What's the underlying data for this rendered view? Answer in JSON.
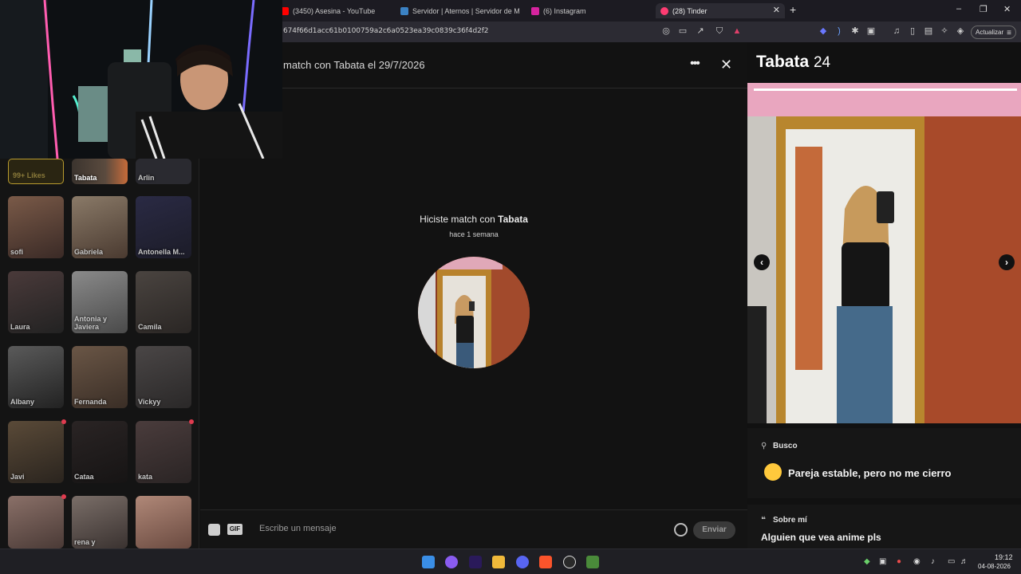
{
  "browser": {
    "tabs": [
      {
        "label": "(3450) Asesina - YouTube",
        "color": "#ff0000"
      },
      {
        "label": "Servidor | Aternos | Servidor de Mine",
        "color": "#3b82c4"
      },
      {
        "label": "(6) Instagram",
        "color": "#d6249f"
      },
      {
        "label": "(28) Tinder",
        "color": "#fe3c72"
      }
    ],
    "new_tab": "+",
    "url": "674f66d1acc61b0100759a2c6a0523ea39c0839c36f4d2f2",
    "update_button": "Actualizar",
    "window_controls": {
      "minimize": "–",
      "maximize": "❐",
      "close": "✕"
    }
  },
  "left_panel": {
    "likes_label": "99+ Likes",
    "matches": [
      {
        "name": "Tabata",
        "color": "#5a4a3e"
      },
      {
        "name": "Arlin",
        "color": "#2a2a30"
      },
      {
        "name": "sofi",
        "color": "#5c4038"
      },
      {
        "name": "Gabriela",
        "color": "#6a5a4a"
      },
      {
        "name": "Antonella M...",
        "color": "#26263a"
      },
      {
        "name": "Laura",
        "color": "#3a3030"
      },
      {
        "name": "Antonia y Javiera",
        "color": "#6a6a6a"
      },
      {
        "name": "Camila",
        "color": "#3a3432"
      },
      {
        "name": "Albany",
        "color": "#3a3a3a"
      },
      {
        "name": "Fernanda",
        "color": "#5a4838"
      },
      {
        "name": "Vickyy",
        "color": "#3a3838"
      },
      {
        "name": "Javi",
        "color": "#3a342c"
      },
      {
        "name": "Cataa",
        "color": "#221e1e"
      },
      {
        "name": "kata",
        "color": "#3a3030"
      },
      {
        "name": "",
        "color": "#6a5650"
      },
      {
        "name": "rena y",
        "color": "#5e5450"
      },
      {
        "name": "",
        "color": "#8a6a5a"
      }
    ]
  },
  "chat": {
    "header_title": "match con Tabata el 29/7/2026",
    "more_label": "•••",
    "close_label": "✕",
    "match_prefix": "Hiciste match con ",
    "match_name": "Tabata",
    "match_when": "hace 1 semana",
    "input_placeholder": "Escribe un mensaje",
    "gif_label": "GIF",
    "send_label": "Enviar"
  },
  "profile": {
    "name": "Tabata",
    "age": "24",
    "prev_arrow": "‹",
    "next_arrow": "›",
    "looking_for_label": "Busco",
    "looking_for_value": "Pareja estable, pero no me cierro",
    "about_label": "Sobre mí",
    "about_text": "Alguien que vea anime pls"
  },
  "taskbar": {
    "time": "19:12",
    "date": "04-08-2026"
  }
}
